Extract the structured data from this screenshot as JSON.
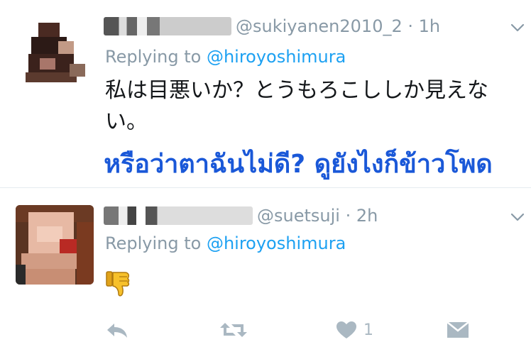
{
  "tweets": [
    {
      "handle": "@sukiyanen2010_2",
      "dot": "·",
      "time": "1h",
      "replying_prefix": "Replying to ",
      "replying_to": "@hiroyoshimura",
      "text": "私は目悪いか？とうもろこししか見えない。",
      "caption": "หรือว่าตาฉันไม่ดี? ดูยังไงก็ข้าวโพด"
    },
    {
      "handle": "@suetsuji",
      "dot": "·",
      "time": "2h",
      "replying_prefix": "Replying to ",
      "replying_to": "@hiroyoshimura",
      "emoji": "thumbs-down",
      "actions": {
        "like_count": "1"
      }
    }
  ],
  "icons": [
    "caret-down-icon",
    "reply-icon",
    "retweet-icon",
    "heart-icon",
    "direct-message-icon",
    "thumbs-down-emoji"
  ],
  "colors": {
    "link": "#1da1f2",
    "muted": "#8899a6",
    "icon": "#aab8c2",
    "caption": "#1a58d8"
  }
}
